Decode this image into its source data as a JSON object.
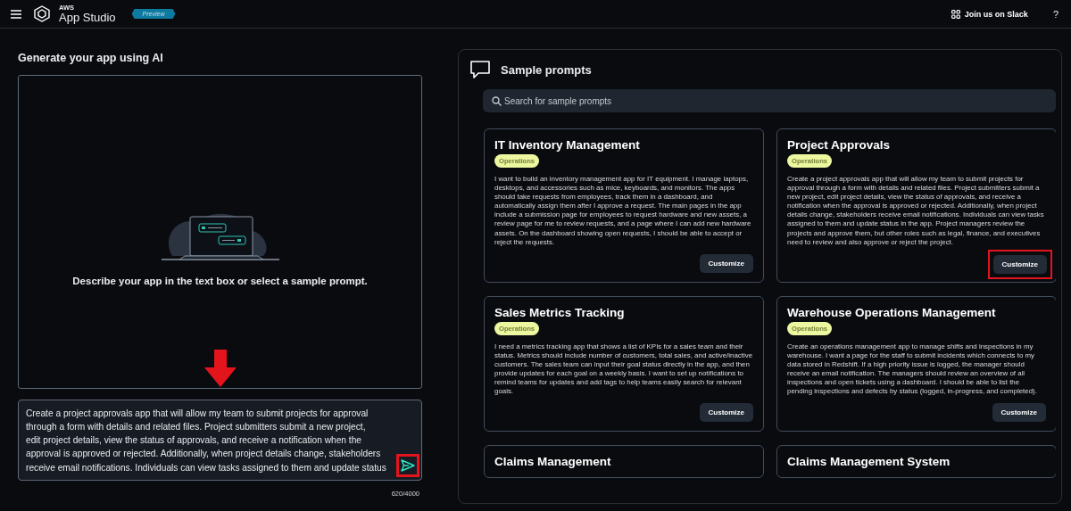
{
  "header": {
    "brand_small": "AWS",
    "brand": "App Studio",
    "badge": "Preview",
    "slack_link": "Join us on Slack",
    "help": "?"
  },
  "generate": {
    "title": "Generate your app using AI",
    "empty_message": "Describe your app in the text box or select a sample prompt.",
    "prompt": {
      "value_lines": [
        "Create a project approvals app that will allow my team to submit projects for approval",
        "through a form with details and related files. Project submitters submit a new project,",
        "edit project details, view the status of approvals, and receive a notification when the",
        "approval is approved or rejected. Additionally, when project details change, stakeholders",
        "receive email notifications. Individuals can view tasks assigned to them and update status"
      ]
    },
    "send_highlighted": true,
    "counter": "620/4000"
  },
  "samples": {
    "title": "Sample prompts",
    "search": {
      "placeholder": "Search for sample prompts"
    },
    "cards": [
      {
        "title": "IT Inventory Management",
        "tag": "Operations",
        "description": "I want to build an inventory management app for IT equipment. I manage laptops, desktops, and accessories such as mice, keyboards, and monitors. The apps should take requests from employees, track them in a dashboard, and automatically assign them after I approve a request. The main pages in the app include a submission page for employees to request hardware and new assets, a review page for me to review requests, and a page where I can add new hardware assets. On the dashboard showing open requests, I should be able to accept or reject the requests.",
        "button": "Customize",
        "highlighted": false
      },
      {
        "title": "Project Approvals",
        "tag": "Operations",
        "description": "Create a project approvals app that will allow my team to submit projects for approval through a form with details and related files. Project submitters submit a new project, edit project details, view the status of approvals, and receive a notification when the approval is approved or rejected. Additionally, when project details change, stakeholders receive email notifications. Individuals can view tasks assigned to them and update status in the app. Project managers review the projects and approve them, but other roles such as legal, finance, and executives need to review and also approve or reject the project.",
        "button": "Customize",
        "highlighted": true
      },
      {
        "title": "Sales Metrics Tracking",
        "tag": "Operations",
        "description": "I need a metrics tracking app that shows a list of KPIs for a sales team and their status. Metrics should include number of customers, total sales, and active/inactive customers. The sales team can input their goal status directly in the app, and then provide updates for each goal on a weekly basis. I want to set up notifications to remind teams for updates and add tags to help teams easily search for relevant goals.",
        "button": "Customize",
        "highlighted": false
      },
      {
        "title": "Warehouse Operations Management",
        "tag": "Operations",
        "description": "Create an operations management app to manage shifts and inspections in my warehouse. I want a page for the staff to submit incidents which connects to my data stored in Redshift. If a high priority issue is logged, the manager should receive an email notification. The managers should review an overview of all inspections and open tickets using a dashboard. I should be able to list the pending inspections and defects by status (logged, in-progress, and completed).",
        "button": "Customize",
        "highlighted": false
      },
      {
        "title": "Claims Management"
      },
      {
        "title": "Claims Management System"
      }
    ]
  }
}
